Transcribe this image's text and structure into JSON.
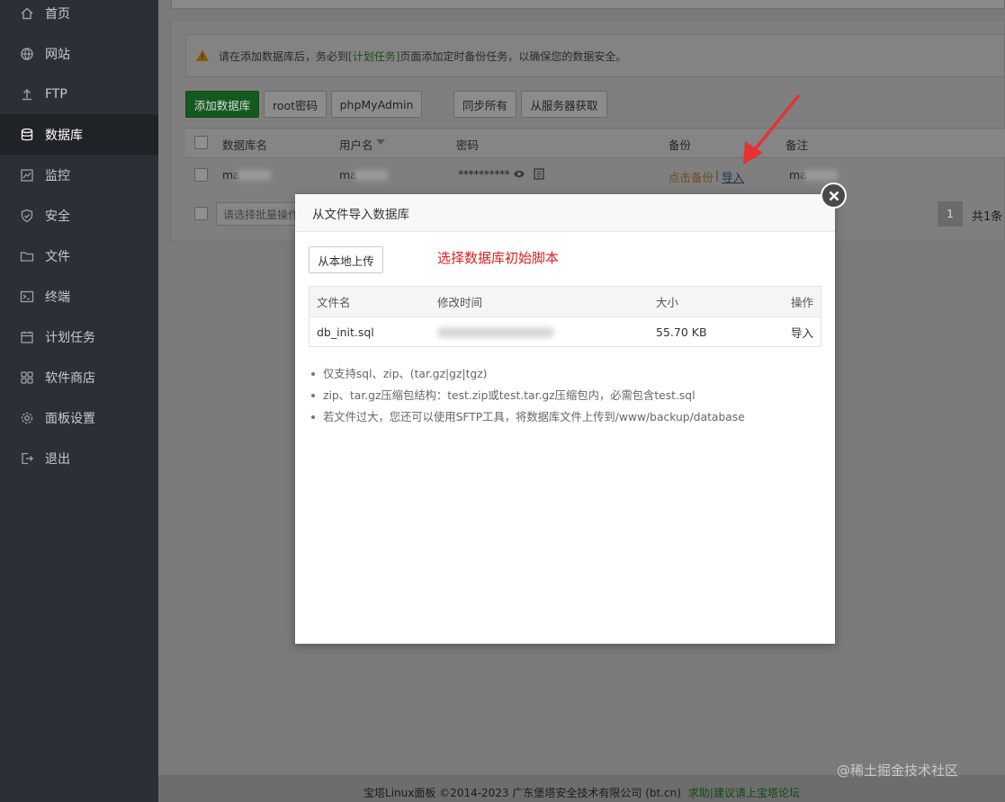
{
  "sidebar": {
    "items": [
      {
        "label": "首页",
        "icon": "home-icon"
      },
      {
        "label": "网站",
        "icon": "globe-icon"
      },
      {
        "label": "FTP",
        "icon": "upload-icon"
      },
      {
        "label": "数据库",
        "icon": "database-icon",
        "active": true
      },
      {
        "label": "监控",
        "icon": "monitor-icon"
      },
      {
        "label": "安全",
        "icon": "shield-icon"
      },
      {
        "label": "文件",
        "icon": "folder-icon"
      },
      {
        "label": "终端",
        "icon": "terminal-icon"
      },
      {
        "label": "计划任务",
        "icon": "calendar-icon"
      },
      {
        "label": "软件商店",
        "icon": "grid-icon"
      },
      {
        "label": "面板设置",
        "icon": "settings-icon"
      },
      {
        "label": "退出",
        "icon": "logout-icon"
      }
    ]
  },
  "warning": {
    "before": "请在添加数据库后，务必到",
    "link": "[计划任务]",
    "after": "页面添加定时备份任务，以确保您的数据安全。"
  },
  "toolbar": {
    "add_db": "添加数据库",
    "root_pwd": "root密码",
    "phpmyadmin": "phpMyAdmin",
    "sync_all": "同步所有",
    "fetch_server": "从服务器获取"
  },
  "db_table": {
    "headers": {
      "name": "数据库名",
      "user": "用户名",
      "password": "密码",
      "backup": "备份",
      "note": "备注"
    },
    "row": {
      "name": "ma",
      "user": "ma",
      "password": "**********",
      "backup_link": "点击备份",
      "separator": "|",
      "import_link": "导入",
      "note": "ma"
    }
  },
  "batch": {
    "placeholder": "请选择批量操作"
  },
  "pager": {
    "current": "1",
    "total": "共1条"
  },
  "modal": {
    "title": "从文件导入数据库",
    "upload_button": "从本地上传",
    "hint": "选择数据库初始脚本",
    "headers": {
      "filename": "文件名",
      "mtime": "修改时间",
      "size": "大小",
      "action": "操作"
    },
    "file": {
      "filename": "db_init.sql",
      "size": "55.70 KB",
      "action": "导入"
    },
    "notes": [
      "仅支持sql、zip、(tar.gz|gz|tgz)",
      "zip、tar.gz压缩包结构：test.zip或test.tar.gz压缩包内，必需包含test.sql",
      "若文件过大，您还可以使用SFTP工具，将数据库文件上传到/www/backup/database"
    ]
  },
  "footer": {
    "copyright": "宝塔Linux面板 ©2014-2023 广东堡塔安全技术有限公司 (bt.cn)",
    "link": "求助|建议请上宝塔论坛"
  },
  "watermark": "@稀土掘金技术社区",
  "colors": {
    "accent_green": "#20a53a",
    "hint_red": "#e02020",
    "arrow_red": "#e83232"
  }
}
